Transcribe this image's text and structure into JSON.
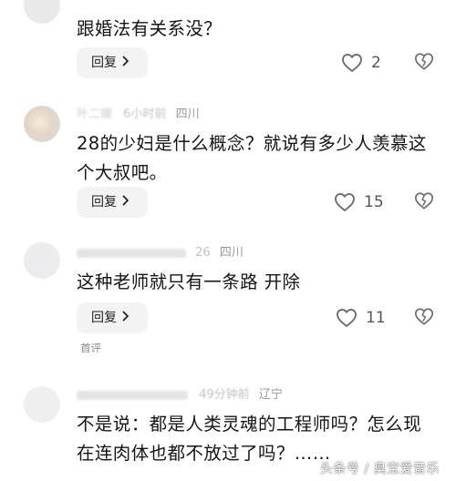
{
  "comments": [
    {
      "text": "跟婚法有关系没？",
      "reply_label": "回复",
      "likes": "2"
    },
    {
      "user": "叶二嫂",
      "time": "6小时前",
      "location": "四川",
      "text": "28的少妇是什么概念？就说有多少人羡慕这个大叔吧。",
      "reply_label": "回复",
      "likes": "15"
    },
    {
      "time": "26",
      "location": "四川",
      "text": "这种老师就只有一条路 开除",
      "reply_label": "回复",
      "likes": "11",
      "tag": "首评"
    },
    {
      "time": "49分钟前",
      "location": "辽宁",
      "text": "不是说：都是人类灵魂的工程师吗？怎么现在连肉体也都不放过了吗？……"
    }
  ],
  "watermark": "头条号 / 臭宝爱音乐",
  "colors": {
    "text": "#151515",
    "meta": "#b8b8bc",
    "reply_bg": "#f3f3f4",
    "icon": "#6f6f73"
  },
  "icons": [
    "heart-icon",
    "broken-heart-icon",
    "chevron-right-icon"
  ]
}
